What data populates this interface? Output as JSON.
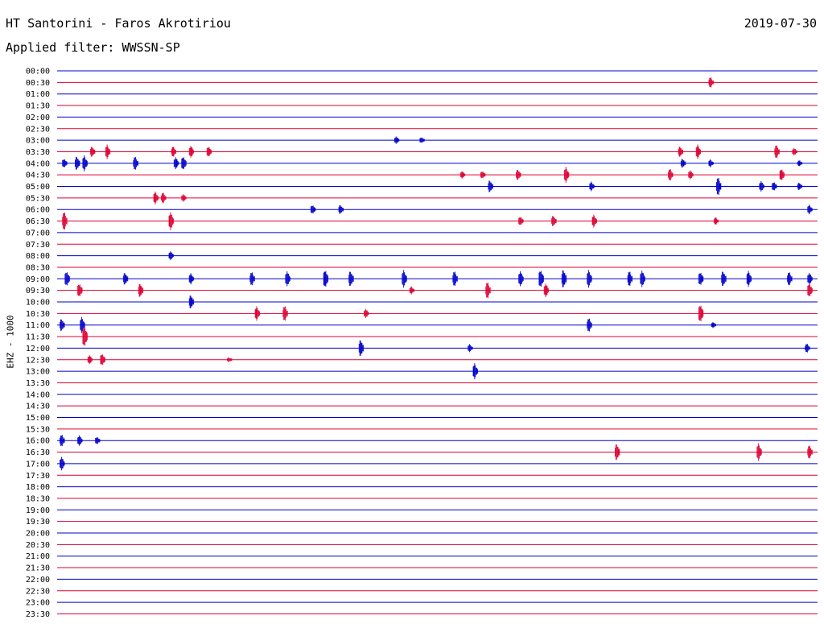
{
  "header": {
    "station": "HT Santorini - Faros Akrotiriou",
    "filter": "Applied filter: WWSSN-SP",
    "date": "2019-07-30",
    "channel": "EHZ - 1000"
  },
  "chart_data": {
    "type": "helicorder",
    "title": "HT Santorini - Faros Akrotiriou",
    "date": "2019-07-30",
    "filter": "WWSSN-SP",
    "ylabel": "EHZ - 1000",
    "time_labels": [
      "00:00",
      "00:30",
      "01:00",
      "01:30",
      "02:00",
      "02:30",
      "03:00",
      "03:30",
      "04:00",
      "04:30",
      "05:00",
      "05:30",
      "06:00",
      "06:30",
      "07:00",
      "07:30",
      "08:00",
      "08:30",
      "09:00",
      "09:30",
      "10:00",
      "10:30",
      "11:00",
      "11:30",
      "12:00",
      "12:30",
      "13:00",
      "13:30",
      "14:00",
      "14:30",
      "15:00",
      "15:30",
      "16:00",
      "16:30",
      "17:00",
      "17:30",
      "18:00",
      "18:30",
      "19:00",
      "19:30",
      "20:00",
      "20:30",
      "21:00",
      "21:30",
      "22:00",
      "22:30",
      "23:00",
      "23:30"
    ],
    "line_colors": [
      "#0000cc",
      "#dd0033"
    ],
    "minutes_per_line": 30,
    "events": [
      {
        "line": "00:30",
        "minute": 25.8,
        "amp": 7
      },
      {
        "line": "03:00",
        "minute": 13.4,
        "amp": 5
      },
      {
        "line": "03:00",
        "minute": 14.4,
        "amp": 4
      },
      {
        "line": "03:30",
        "minute": 1.4,
        "amp": 7
      },
      {
        "line": "03:30",
        "minute": 2.0,
        "amp": 9
      },
      {
        "line": "03:30",
        "minute": 4.6,
        "amp": 7
      },
      {
        "line": "03:30",
        "minute": 5.3,
        "amp": 8
      },
      {
        "line": "03:30",
        "minute": 6.0,
        "amp": 7
      },
      {
        "line": "03:30",
        "minute": 24.6,
        "amp": 7
      },
      {
        "line": "03:30",
        "minute": 25.3,
        "amp": 9
      },
      {
        "line": "03:30",
        "minute": 28.4,
        "amp": 9
      },
      {
        "line": "03:30",
        "minute": 29.1,
        "amp": 5
      },
      {
        "line": "04:00",
        "minute": 0.3,
        "amp": 6
      },
      {
        "line": "04:00",
        "minute": 0.8,
        "amp": 9
      },
      {
        "line": "04:00",
        "minute": 1.1,
        "amp": 10
      },
      {
        "line": "04:00",
        "minute": 3.1,
        "amp": 9
      },
      {
        "line": "04:00",
        "minute": 4.7,
        "amp": 8
      },
      {
        "line": "04:00",
        "minute": 5.0,
        "amp": 9
      },
      {
        "line": "04:00",
        "minute": 24.7,
        "amp": 6
      },
      {
        "line": "04:00",
        "minute": 25.8,
        "amp": 5
      },
      {
        "line": "04:00",
        "minute": 29.3,
        "amp": 4
      },
      {
        "line": "04:30",
        "minute": 16.0,
        "amp": 5
      },
      {
        "line": "04:30",
        "minute": 16.8,
        "amp": 5
      },
      {
        "line": "04:30",
        "minute": 18.2,
        "amp": 7
      },
      {
        "line": "04:30",
        "minute": 20.1,
        "amp": 10
      },
      {
        "line": "04:30",
        "minute": 24.2,
        "amp": 8
      },
      {
        "line": "04:30",
        "minute": 25.0,
        "amp": 6
      },
      {
        "line": "04:30",
        "minute": 28.6,
        "amp": 8
      },
      {
        "line": "05:00",
        "minute": 17.1,
        "amp": 8
      },
      {
        "line": "05:00",
        "minute": 21.1,
        "amp": 6
      },
      {
        "line": "05:00",
        "minute": 26.1,
        "amp": 12
      },
      {
        "line": "05:00",
        "minute": 27.8,
        "amp": 7
      },
      {
        "line": "05:00",
        "minute": 28.3,
        "amp": 6
      },
      {
        "line": "05:00",
        "minute": 29.3,
        "amp": 5
      },
      {
        "line": "05:30",
        "minute": 3.9,
        "amp": 8
      },
      {
        "line": "05:30",
        "minute": 4.2,
        "amp": 7
      },
      {
        "line": "05:30",
        "minute": 5.0,
        "amp": 5
      },
      {
        "line": "06:00",
        "minute": 10.1,
        "amp": 6
      },
      {
        "line": "06:00",
        "minute": 11.2,
        "amp": 6
      },
      {
        "line": "06:00",
        "minute": 29.7,
        "amp": 6
      },
      {
        "line": "06:30",
        "minute": 0.3,
        "amp": 12
      },
      {
        "line": "06:30",
        "minute": 4.5,
        "amp": 12
      },
      {
        "line": "06:30",
        "minute": 18.3,
        "amp": 6
      },
      {
        "line": "06:30",
        "minute": 19.6,
        "amp": 7
      },
      {
        "line": "06:30",
        "minute": 21.2,
        "amp": 8
      },
      {
        "line": "06:30",
        "minute": 26.0,
        "amp": 5
      },
      {
        "line": "08:00",
        "minute": 4.5,
        "amp": 6
      },
      {
        "line": "09:00",
        "minute": 0.4,
        "amp": 10
      },
      {
        "line": "09:00",
        "minute": 2.7,
        "amp": 8
      },
      {
        "line": "09:00",
        "minute": 5.3,
        "amp": 7
      },
      {
        "line": "09:00",
        "minute": 7.7,
        "amp": 9
      },
      {
        "line": "09:00",
        "minute": 9.1,
        "amp": 10
      },
      {
        "line": "09:00",
        "minute": 10.6,
        "amp": 12
      },
      {
        "line": "09:00",
        "minute": 11.6,
        "amp": 10
      },
      {
        "line": "09:00",
        "minute": 13.7,
        "amp": 11
      },
      {
        "line": "09:00",
        "minute": 15.7,
        "amp": 10
      },
      {
        "line": "09:00",
        "minute": 18.3,
        "amp": 10
      },
      {
        "line": "09:00",
        "minute": 19.1,
        "amp": 12
      },
      {
        "line": "09:00",
        "minute": 20.0,
        "amp": 12
      },
      {
        "line": "09:00",
        "minute": 21.0,
        "amp": 11
      },
      {
        "line": "09:00",
        "minute": 22.6,
        "amp": 10
      },
      {
        "line": "09:00",
        "minute": 23.1,
        "amp": 11
      },
      {
        "line": "09:00",
        "minute": 25.4,
        "amp": 9
      },
      {
        "line": "09:00",
        "minute": 26.3,
        "amp": 10
      },
      {
        "line": "09:00",
        "minute": 27.3,
        "amp": 10
      },
      {
        "line": "09:00",
        "minute": 28.9,
        "amp": 9
      },
      {
        "line": "09:00",
        "minute": 29.7,
        "amp": 8
      },
      {
        "line": "09:30",
        "minute": 0.9,
        "amp": 9
      },
      {
        "line": "09:30",
        "minute": 3.3,
        "amp": 9
      },
      {
        "line": "09:30",
        "minute": 14.0,
        "amp": 5
      },
      {
        "line": "09:30",
        "minute": 17.0,
        "amp": 11
      },
      {
        "line": "09:30",
        "minute": 19.3,
        "amp": 9
      },
      {
        "line": "09:30",
        "minute": 29.7,
        "amp": 9
      },
      {
        "line": "10:00",
        "minute": 5.3,
        "amp": 9
      },
      {
        "line": "10:30",
        "minute": 7.9,
        "amp": 9
      },
      {
        "line": "10:30",
        "minute": 9.0,
        "amp": 10
      },
      {
        "line": "10:30",
        "minute": 12.2,
        "amp": 6
      },
      {
        "line": "10:30",
        "minute": 25.4,
        "amp": 12
      },
      {
        "line": "11:00",
        "minute": 0.2,
        "amp": 8
      },
      {
        "line": "11:00",
        "minute": 1.0,
        "amp": 10
      },
      {
        "line": "11:00",
        "minute": 21.0,
        "amp": 9
      },
      {
        "line": "11:00",
        "minute": 25.9,
        "amp": 4
      },
      {
        "line": "11:30",
        "minute": 1.1,
        "amp": 14
      },
      {
        "line": "12:00",
        "minute": 12.0,
        "amp": 11
      },
      {
        "line": "12:00",
        "minute": 16.3,
        "amp": 5
      },
      {
        "line": "12:00",
        "minute": 29.6,
        "amp": 6
      },
      {
        "line": "12:30",
        "minute": 1.3,
        "amp": 6
      },
      {
        "line": "12:30",
        "minute": 1.8,
        "amp": 8
      },
      {
        "line": "12:30",
        "minute": 6.8,
        "amp": 3
      },
      {
        "line": "13:00",
        "minute": 16.5,
        "amp": 10
      },
      {
        "line": "16:00",
        "minute": 0.2,
        "amp": 8
      },
      {
        "line": "16:00",
        "minute": 0.9,
        "amp": 7
      },
      {
        "line": "16:00",
        "minute": 1.6,
        "amp": 5
      },
      {
        "line": "16:30",
        "minute": 22.1,
        "amp": 11
      },
      {
        "line": "16:30",
        "minute": 27.7,
        "amp": 11
      },
      {
        "line": "16:30",
        "minute": 29.7,
        "amp": 9
      },
      {
        "line": "17:00",
        "minute": 0.2,
        "amp": 9
      }
    ]
  }
}
